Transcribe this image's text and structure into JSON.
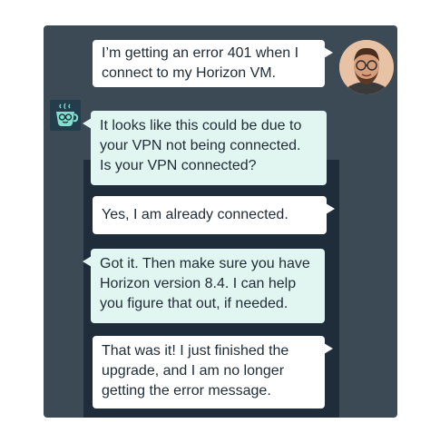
{
  "conversation": {
    "messages": [
      {
        "sender": "user",
        "lines": [
          "I’m getting an error 401 when I",
          "connect to my Horizon VM."
        ]
      },
      {
        "sender": "bot",
        "lines": [
          "It looks like this could be due to",
          "your VPN not being connected.",
          "Is your VPN connected?"
        ]
      },
      {
        "sender": "user",
        "lines": [
          "Yes, I am already connected."
        ]
      },
      {
        "sender": "bot",
        "lines": [
          "Got it. Then make sure you have",
          "Horizon version 8.4. I can help",
          "you figure that out, if needed."
        ]
      },
      {
        "sender": "user",
        "lines": [
          "That was it! I just finished the",
          "upgrade, and I am no longer",
          "getting the error message."
        ]
      }
    ]
  },
  "icons": {
    "user_avatar": "user-avatar-photo",
    "bot_avatar": "coffee-cup-with-glasses-icon"
  },
  "colors": {
    "panel": "#3b4a55",
    "inner_panel": "#1f2d3a",
    "user_bubble": "#ffffff",
    "bot_bubble": "#e1f6f1",
    "text": "#1f2b35",
    "bot_icon_accent": "#7fe0d0"
  }
}
